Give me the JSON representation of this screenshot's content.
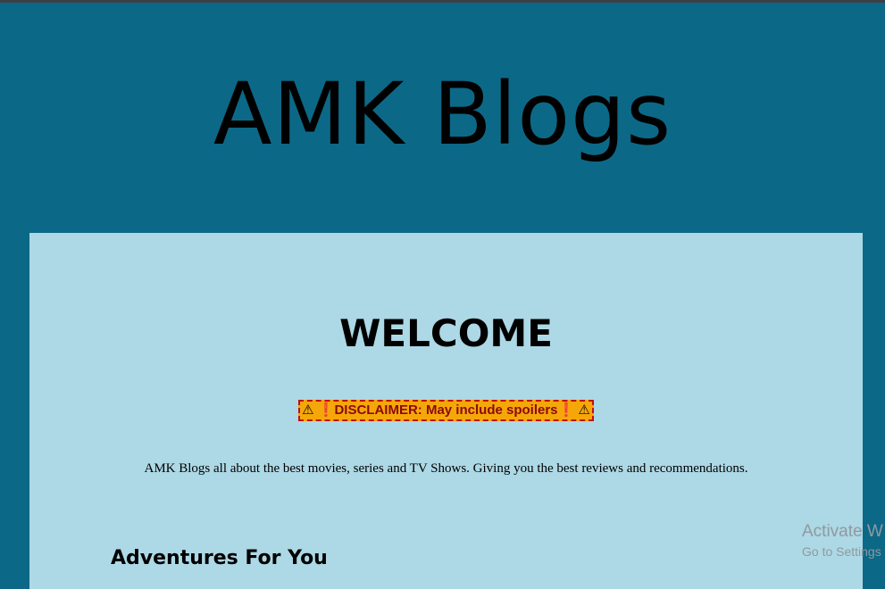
{
  "site": {
    "title": "AMK Blogs"
  },
  "main": {
    "welcome_heading": "WELCOME",
    "disclaimer": {
      "warning_glyph": "⚠",
      "exclamation_glyph": "❗",
      "text": "DISCLAIMER: May include spoilers"
    },
    "intro": "AMK Blogs all about the best movies, series and TV Shows. Giving you the best reviews and recommendations.",
    "section_heading": "Adventures For You"
  },
  "watermark": {
    "title": "Activate W",
    "subtitle": "Go to Settings"
  },
  "colors": {
    "page_background": "#0c6887",
    "content_background": "#add8e5",
    "disclaimer_background": "#f5a70a",
    "disclaimer_border": "#c01010",
    "disclaimer_text": "#8a0a0a"
  }
}
